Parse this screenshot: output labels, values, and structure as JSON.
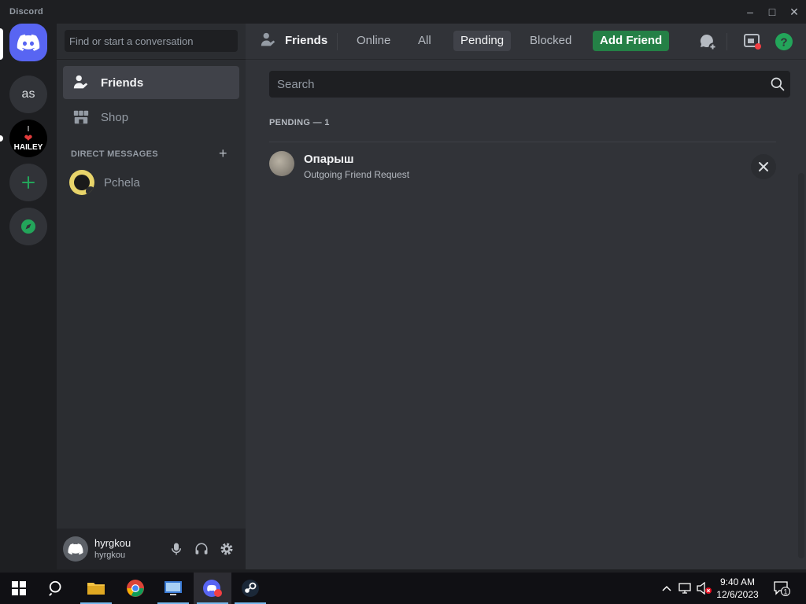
{
  "app": {
    "title": "Discord"
  },
  "servers": [
    {
      "label": "as"
    },
    {
      "line1": "I",
      "line2": "HAILEY"
    }
  ],
  "sidebar": {
    "search_placeholder": "Find or start a conversation",
    "nav": [
      {
        "label": "Friends",
        "icon": "friends-icon"
      },
      {
        "label": "Shop",
        "icon": "shop-icon"
      }
    ],
    "dm_header": "DIRECT MESSAGES",
    "dms": [
      {
        "name": "Pchela"
      }
    ]
  },
  "user": {
    "display_name": "hyrgkou",
    "username": "hyrgkou"
  },
  "topbar": {
    "title": "Friends",
    "tabs": [
      {
        "label": "Online"
      },
      {
        "label": "All"
      },
      {
        "label": "Pending",
        "selected": true
      },
      {
        "label": "Blocked"
      },
      {
        "label": "Add Friend"
      }
    ]
  },
  "main": {
    "search_placeholder": "Search",
    "section_title": "PENDING — 1",
    "requests": [
      {
        "name": "Опарыш",
        "subtitle": "Outgoing Friend Request"
      }
    ]
  },
  "taskbar": {
    "time": "9:40 AM",
    "date": "12/6/2023",
    "notification_count": "1"
  },
  "colors": {
    "blurple": "#5865f2",
    "green": "#248046",
    "help_green": "#23a55a",
    "red": "#f23f43"
  }
}
